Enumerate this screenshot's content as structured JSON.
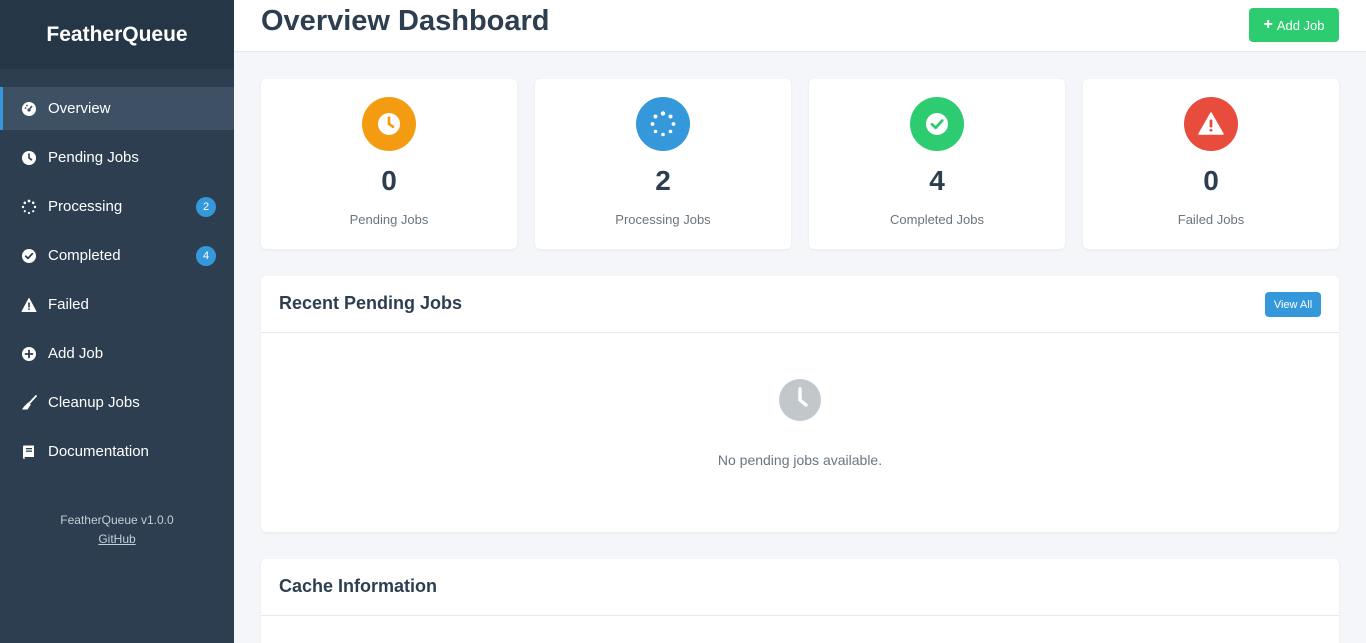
{
  "app": {
    "brand": "FeatherQueue"
  },
  "sidebar": {
    "items": [
      {
        "label": "Overview",
        "icon": "gauge-icon",
        "active": true
      },
      {
        "label": "Pending Jobs",
        "icon": "clock-icon"
      },
      {
        "label": "Processing",
        "icon": "spinner-icon",
        "badge": "2"
      },
      {
        "label": "Completed",
        "icon": "check-circle-icon",
        "badge": "4"
      },
      {
        "label": "Failed",
        "icon": "warning-icon"
      },
      {
        "label": "Add Job",
        "icon": "plus-circle-icon"
      },
      {
        "label": "Cleanup Jobs",
        "icon": "broom-icon"
      },
      {
        "label": "Documentation",
        "icon": "book-icon"
      }
    ],
    "footer": {
      "version": "FeatherQueue v1.0.0",
      "link": "GitHub"
    }
  },
  "header": {
    "title": "Overview Dashboard",
    "add_label": "Add Job"
  },
  "stats": [
    {
      "value": "0",
      "label": "Pending Jobs",
      "color": "#f39c12",
      "icon": "clock-icon"
    },
    {
      "value": "2",
      "label": "Processing Jobs",
      "color": "#3498db",
      "icon": "spinner-icon"
    },
    {
      "value": "4",
      "label": "Completed Jobs",
      "color": "#2ecc71",
      "icon": "check-circle-icon"
    },
    {
      "value": "0",
      "label": "Failed Jobs",
      "color": "#e74c3c",
      "icon": "warning-icon"
    }
  ],
  "recent": {
    "title": "Recent Pending Jobs",
    "view_all": "View All",
    "empty": "No pending jobs available."
  },
  "cache": {
    "title": "Cache Information"
  },
  "colors": {
    "sidebar": "#2c3e50",
    "accent": "#3498db",
    "success": "#2ecc71",
    "warning": "#f39c12",
    "danger": "#e74c3c"
  }
}
